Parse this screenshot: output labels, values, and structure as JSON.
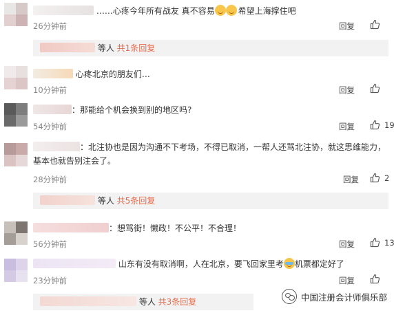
{
  "comments": [
    {
      "text": "……心疼今年所有战友 真不容易",
      "text_tail": "希望上海撑住吧",
      "time": "26分钟前",
      "reply_label": "回复",
      "likes": "",
      "sub": {
        "suffix": "等人",
        "count_text": "共1条回复"
      }
    },
    {
      "text": "心疼北京的朋友们…",
      "time": "10分钟前",
      "reply_label": "回复",
      "likes": ""
    },
    {
      "text": "：那能给个机会换到别的地区吗?",
      "time": "54分钟前",
      "reply_label": "回复",
      "likes": "19"
    },
    {
      "text": "：北注协也是因为沟通不下考场，不得已取消，一帮人还骂北注协，就这思维能力，基本也就告别注会了。",
      "time": "28分钟前",
      "reply_label": "回复",
      "likes": "2",
      "sub": {
        "suffix": "等人",
        "count_text": "共5条回复"
      }
    },
    {
      "text": "：想骂街！懒政！不公平！不合理！",
      "time": "56分钟前",
      "reply_label": "回复",
      "likes": "13"
    },
    {
      "text": "山东有没有取消啊，人在北京，要飞回家里考",
      "text_tail": "机票都定好了",
      "time": "23分钟前",
      "reply_label": "回复",
      "likes": "",
      "sub": {
        "suffix": "等人",
        "count_text": "共3条回复"
      }
    }
  ],
  "watermark": {
    "text": "中国注册会计师俱乐部",
    "icon": "wechat-icon"
  },
  "colors": {
    "accent": "#e86a4a",
    "time": "#888888",
    "subbox": "#f2f2f2"
  }
}
